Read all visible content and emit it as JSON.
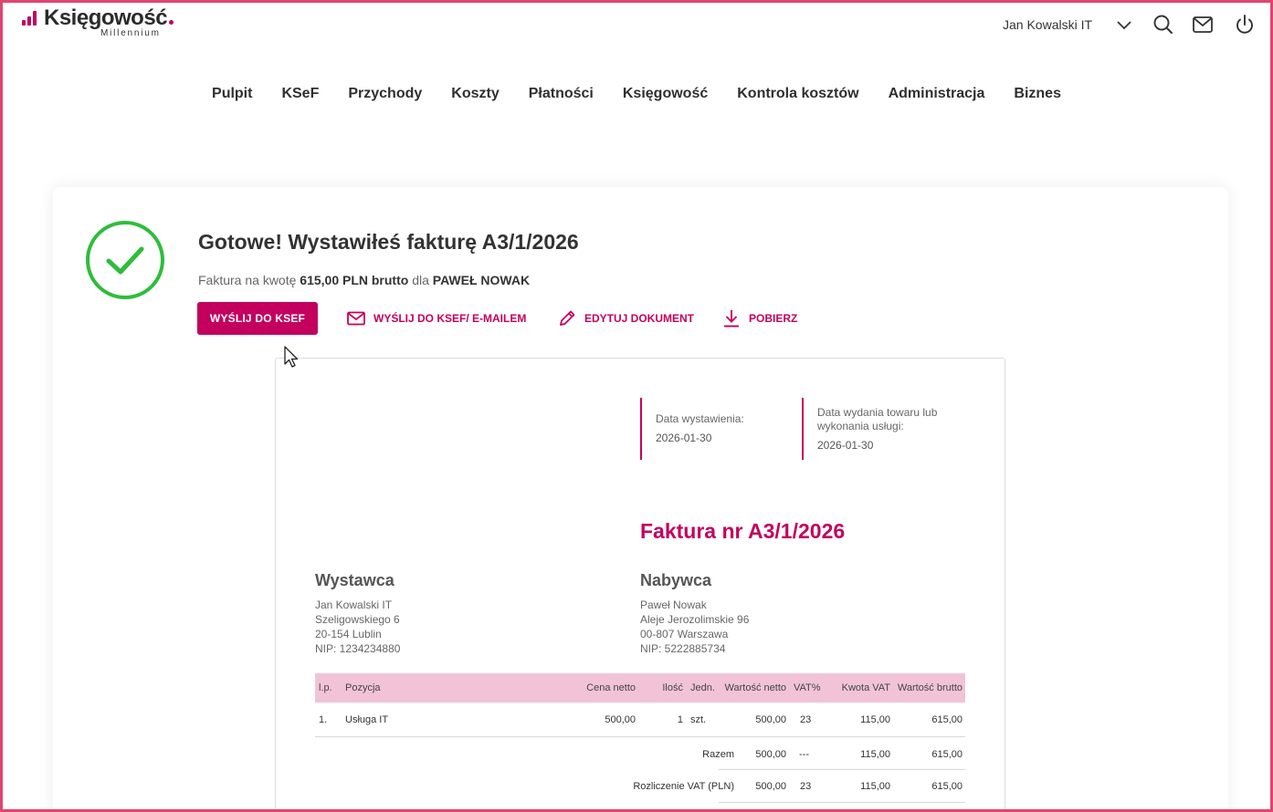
{
  "brand": {
    "name": "Księgowość",
    "sub": "Millennium",
    "color": "#c3005e"
  },
  "header": {
    "user": "Jan Kowalski IT",
    "icons": [
      "chevron-down-icon",
      "search-icon",
      "mail-icon",
      "power-icon"
    ]
  },
  "nav": [
    "Pulpit",
    "KSeF",
    "Przychody",
    "Koszty",
    "Płatności",
    "Księgowość",
    "Kontrola kosztów",
    "Administracja",
    "Biznes"
  ],
  "success": {
    "title": "Gotowe! Wystawiłeś fakturę A3/1/2026",
    "summary_prefix": "Faktura na kwotę",
    "amount": "615,00 PLN brutto",
    "summary_mid": "dla",
    "client": "PAWEŁ NOWAK"
  },
  "actions": {
    "primary": "WYŚLIJ DO KSEF",
    "send_email": "WYŚLIJ DO KSEF/ E-MAILEM",
    "edit": "EDYTUJ DOKUMENT",
    "download": "POBIERZ"
  },
  "invoice": {
    "issue_date_label": "Data wystawienia:",
    "issue_date": "2026-01-30",
    "delivery_date_label_1": "Data wydania towaru lub",
    "delivery_date_label_2": "wykonania usługi:",
    "delivery_date": "2026-01-30",
    "title": "Faktura nr A3/1/2026",
    "seller": {
      "heading": "Wystawca",
      "lines": [
        "Jan Kowalski IT",
        "Szeligowskiego 6",
        "20-154 Lublin",
        "NIP: 1234234880"
      ]
    },
    "buyer": {
      "heading": "Nabywca",
      "lines": [
        "Paweł Nowak",
        "Aleje Jerozolimskie 96",
        "00-807 Warszawa",
        "NIP: 5222885734"
      ]
    },
    "columns": {
      "lp": "l.p.",
      "item": "Pozycja",
      "net_price": "Cena netto",
      "qty": "Ilość",
      "unit": "Jedn.",
      "net_value": "Wartość netto",
      "vat_rate": "VAT%",
      "vat_amount": "Kwota VAT",
      "gross_value": "Wartość brutto"
    },
    "rows": [
      {
        "lp": "1.",
        "item": "Usługa IT",
        "net_price": "500,00",
        "qty": "1",
        "unit": "szt.",
        "net_value": "500,00",
        "vat_rate": "23",
        "vat_amount": "115,00",
        "gross_value": "615,00"
      }
    ],
    "total": {
      "label": "Razem",
      "net_value": "500,00",
      "vat_rate": "---",
      "vat_amount": "115,00",
      "gross_value": "615,00"
    },
    "vat_summary": {
      "label": "Rozliczenie VAT (PLN)",
      "net_value": "500,00",
      "vat_rate": "23",
      "vat_amount": "115,00",
      "gross_value": "615,00"
    }
  }
}
